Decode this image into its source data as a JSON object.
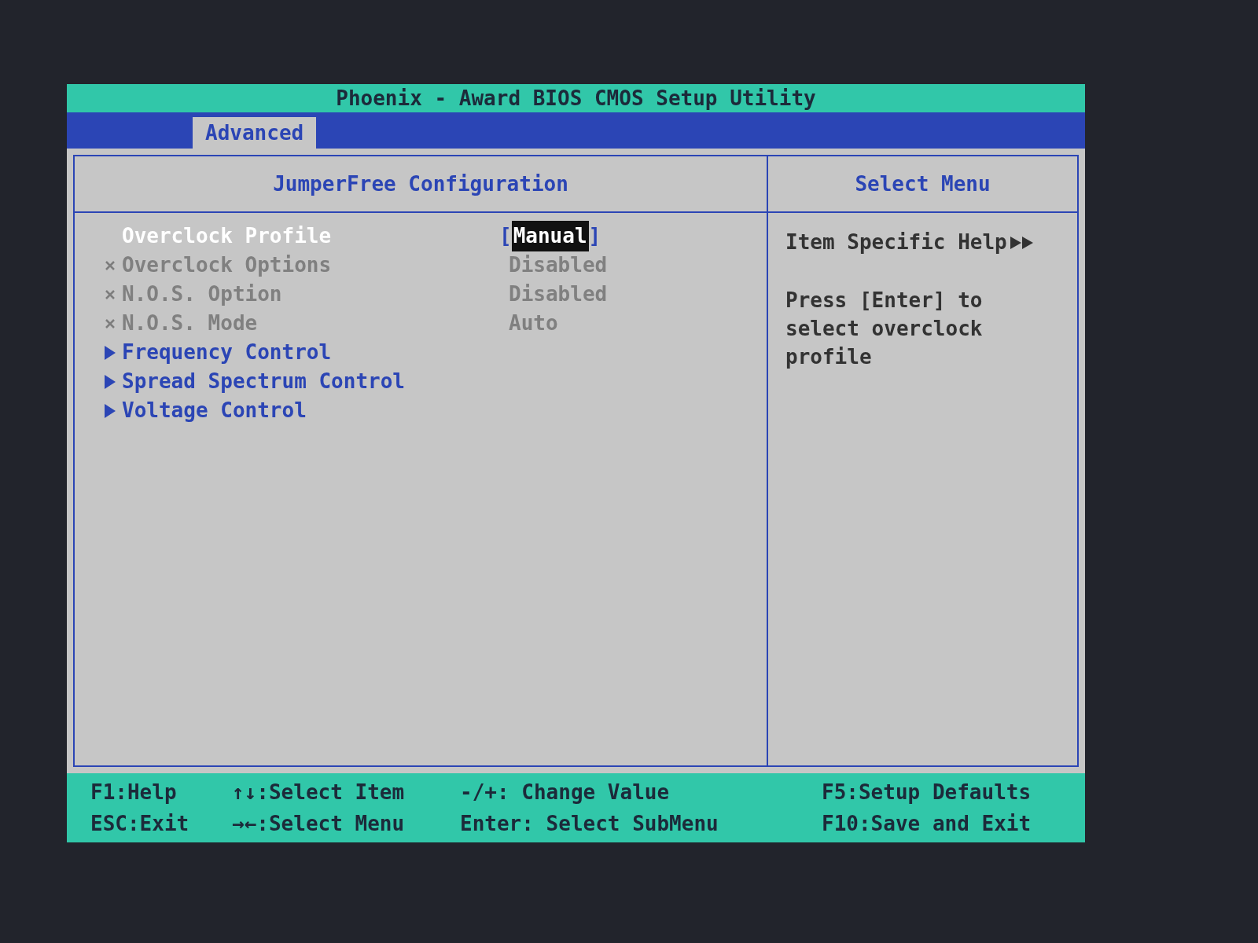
{
  "window": {
    "title": "Phoenix - Award BIOS CMOS Setup Utility"
  },
  "tabs": [
    {
      "label": "Advanced",
      "selected": true
    }
  ],
  "panel": {
    "title": "JumperFree Configuration"
  },
  "items": [
    {
      "kind": "setting",
      "label": "Overclock Profile",
      "bracket_left": "[",
      "value": "Manual",
      "bracket_right": "]",
      "selected": true,
      "disabled": false
    },
    {
      "kind": "setting",
      "label": "Overclock Options",
      "value": "Disabled",
      "selected": false,
      "disabled": true
    },
    {
      "kind": "setting",
      "label": "N.O.S. Option",
      "value": "Disabled",
      "selected": false,
      "disabled": true
    },
    {
      "kind": "setting",
      "label": "N.O.S. Mode",
      "value": "Auto",
      "selected": false,
      "disabled": true
    },
    {
      "kind": "submenu",
      "label": "Frequency Control",
      "selected": false
    },
    {
      "kind": "submenu",
      "label": "Spread Spectrum Control",
      "selected": false
    },
    {
      "kind": "submenu",
      "label": "Voltage Control",
      "selected": false
    }
  ],
  "help": {
    "title": "Select Menu",
    "heading": "Item Specific Help",
    "text": "Press [Enter] to select overclock profile"
  },
  "footer": [
    [
      "F1:Help",
      "ESC:Exit"
    ],
    [
      "↑↓:Select Item",
      "→←:Select Menu"
    ],
    [
      "-/+: Change Value",
      "Enter: Select SubMenu"
    ],
    [
      "F5:Setup Defaults",
      "F10:Save and Exit"
    ]
  ]
}
